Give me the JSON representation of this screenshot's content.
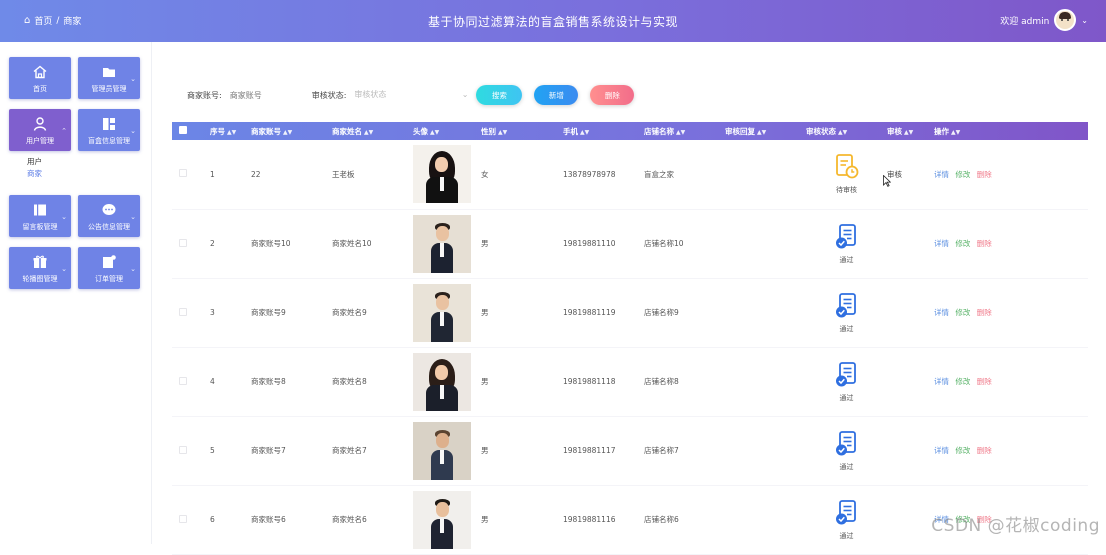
{
  "header": {
    "breadcrumb_home": "首页",
    "breadcrumb_sep": "/",
    "breadcrumb_current": "商家",
    "title": "基于协同过滤算法的盲盒销售系统设计与实现",
    "welcome": "欢迎 admin"
  },
  "sidebar": {
    "tiles": [
      {
        "label": "首页",
        "icon": "home-icon"
      },
      {
        "label": "管理员管理",
        "icon": "folder-icon"
      },
      {
        "label": "用户管理",
        "icon": "user-icon"
      },
      {
        "label": "盲盒信息管理",
        "icon": "grid-icon"
      },
      {
        "label": "留言板管理",
        "icon": "board-icon"
      },
      {
        "label": "公告信息管理",
        "icon": "chat-icon"
      },
      {
        "label": "轮播图管理",
        "icon": "gift-icon"
      },
      {
        "label": "订单管理",
        "icon": "order-icon"
      }
    ],
    "submenu": [
      "用户",
      "商家"
    ]
  },
  "search": {
    "account_label": "商家账号:",
    "account_placeholder": "商家账号",
    "status_label": "审核状态:",
    "status_placeholder": "审核状态",
    "btn_search": "搜索",
    "btn_add": "新增",
    "btn_delete": "删除"
  },
  "table": {
    "headers": [
      "序号",
      "商家账号",
      "商家姓名",
      "头像",
      "性别",
      "手机",
      "店铺名称",
      "审核回复",
      "审核状态",
      "审核",
      "操作"
    ],
    "rows": [
      {
        "no": "1",
        "account": "22",
        "name": "王老板",
        "gender": "女",
        "phone": "13878978978",
        "shop": "盲盒之家",
        "reply": "",
        "status": "待审核",
        "audit": "审核"
      },
      {
        "no": "2",
        "account": "商家账号10",
        "name": "商家姓名10",
        "gender": "男",
        "phone": "19819881110",
        "shop": "店铺名称10",
        "reply": "",
        "status": "通过",
        "audit": ""
      },
      {
        "no": "3",
        "account": "商家账号9",
        "name": "商家姓名9",
        "gender": "男",
        "phone": "19819881119",
        "shop": "店铺名称9",
        "reply": "",
        "status": "通过",
        "audit": ""
      },
      {
        "no": "4",
        "account": "商家账号8",
        "name": "商家姓名8",
        "gender": "男",
        "phone": "19819881118",
        "shop": "店铺名称8",
        "reply": "",
        "status": "通过",
        "audit": ""
      },
      {
        "no": "5",
        "account": "商家账号7",
        "name": "商家姓名7",
        "gender": "男",
        "phone": "19819881117",
        "shop": "店铺名称7",
        "reply": "",
        "status": "通过",
        "audit": ""
      },
      {
        "no": "6",
        "account": "商家账号6",
        "name": "商家姓名6",
        "gender": "男",
        "phone": "19819881116",
        "shop": "店铺名称6",
        "reply": "",
        "status": "通过",
        "audit": ""
      }
    ],
    "ops": {
      "detail": "详情",
      "edit": "修改",
      "delete": "删除"
    }
  },
  "watermark": "CSDN @花椒coding",
  "colors": {
    "header_start": "#6f8ae8",
    "header_end": "#7f57c9",
    "tile": "#6f83e6",
    "tile_active": "#7f5fce",
    "pending": "#f5b82e",
    "passed": "#2f6fe0"
  }
}
